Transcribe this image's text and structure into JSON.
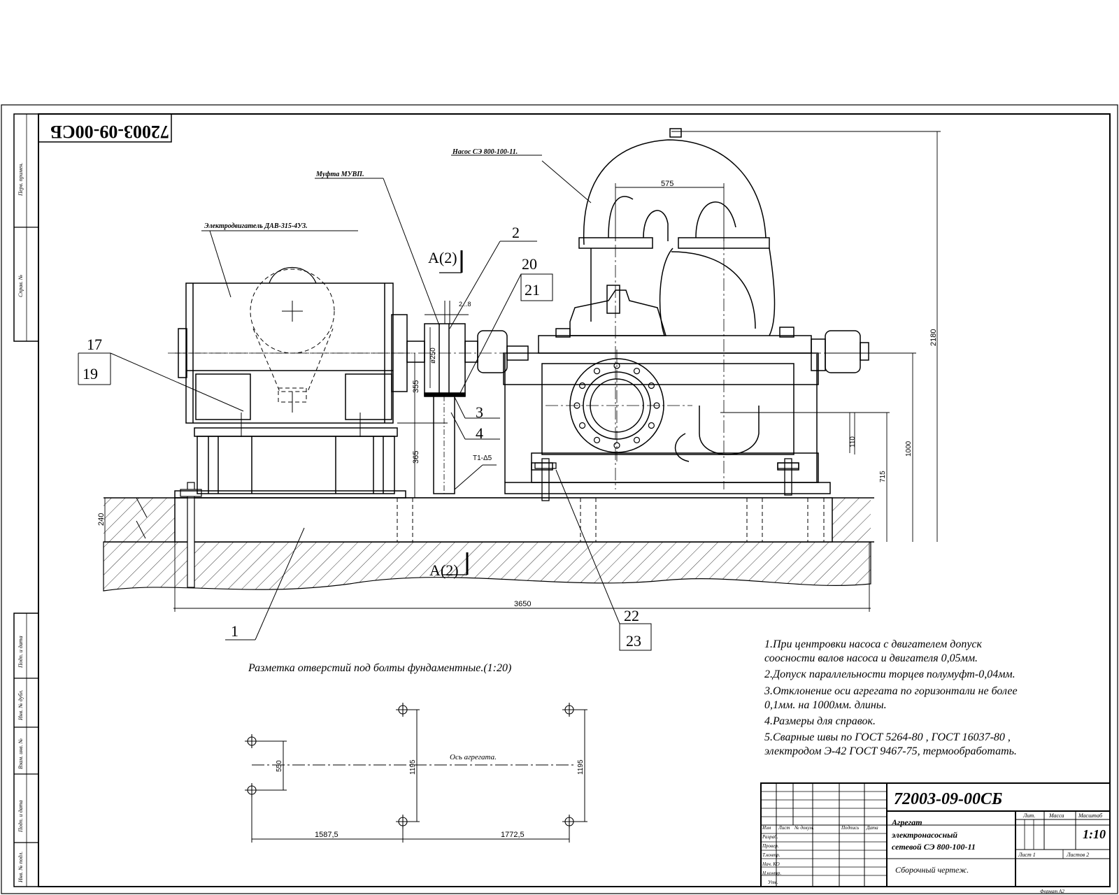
{
  "doc_number": "72003-09-00СБ",
  "doc_number_rotated": "72003-09-00СБ",
  "callouts": {
    "pump": "Насос СЭ 800-100-11.",
    "coupling": "Муфта МУВП.",
    "motor": "Электродвигатель ДАВ-315-4У3.",
    "section": "А(2)",
    "section2": "А(2)"
  },
  "positions": [
    "17",
    "19",
    "2",
    "20",
    "21",
    "3",
    "4",
    "1",
    "22",
    "23"
  ],
  "dimensions": {
    "d575": "575",
    "d2180": "2180",
    "d2_8": "2...8",
    "d250": "ø250",
    "d355": "355",
    "d365": "365",
    "d240": "240",
    "d110": "110",
    "d1000": "1000",
    "d715": "715",
    "d3650": "3650",
    "weld": "Т1-Δ5",
    "d550": "550",
    "d1195a": "1195",
    "d1195b": "1195",
    "d1587": "1587,5",
    "d1772": "1772,5"
  },
  "layout_title": "Разметка отверстий под болты фундаментные.(1:20)",
  "axis_label": "Ось агрегата.",
  "notes": [
    "1.При центровки насоса с двигателем допуск",
    "соосности валов насоса и двигателя 0,05мм.",
    "2.Допуск параллельности торцев полумуфт-0,04мм.",
    "3.Отклонение оси агрегата по горизонтали не более",
    "0,1мм. на 1000мм. длины.",
    "4.Размеры для справок.",
    "5.Сварные швы по ГОСТ 5264-80 , ГОСТ 16037-80 ,",
    "электродом Э-42 ГОСТ 9467-75, термообработать."
  ],
  "title_block": {
    "number": "72003-09-00СБ",
    "name_line1": "Агрегат",
    "name_line2": "электронасосный",
    "name_line3": "сетевой СЭ 800-100-11",
    "doc_type": "Сборочный чертеж.",
    "col_lit": "Лит.",
    "col_mass": "Масса",
    "col_scale": "Масштаб",
    "scale": "1:10",
    "sheet": "Лист 1",
    "sheets": "Листов 2",
    "row_headers": [
      "Изм",
      "Лист",
      "№ докум.",
      "Подпись",
      "Дата"
    ],
    "roles": [
      "Разраб.",
      "Провер.",
      "Т.контр.",
      "Нач. КО",
      "Н.контр.",
      "Утв."
    ],
    "format": "Формат А2"
  },
  "side_labels": [
    "Перв. примен.",
    "Справ. №",
    "Подп. и дата",
    "Инв. № дубл.",
    "Взам. инв. №",
    "Подп. и дата",
    "Инв. № подл."
  ]
}
